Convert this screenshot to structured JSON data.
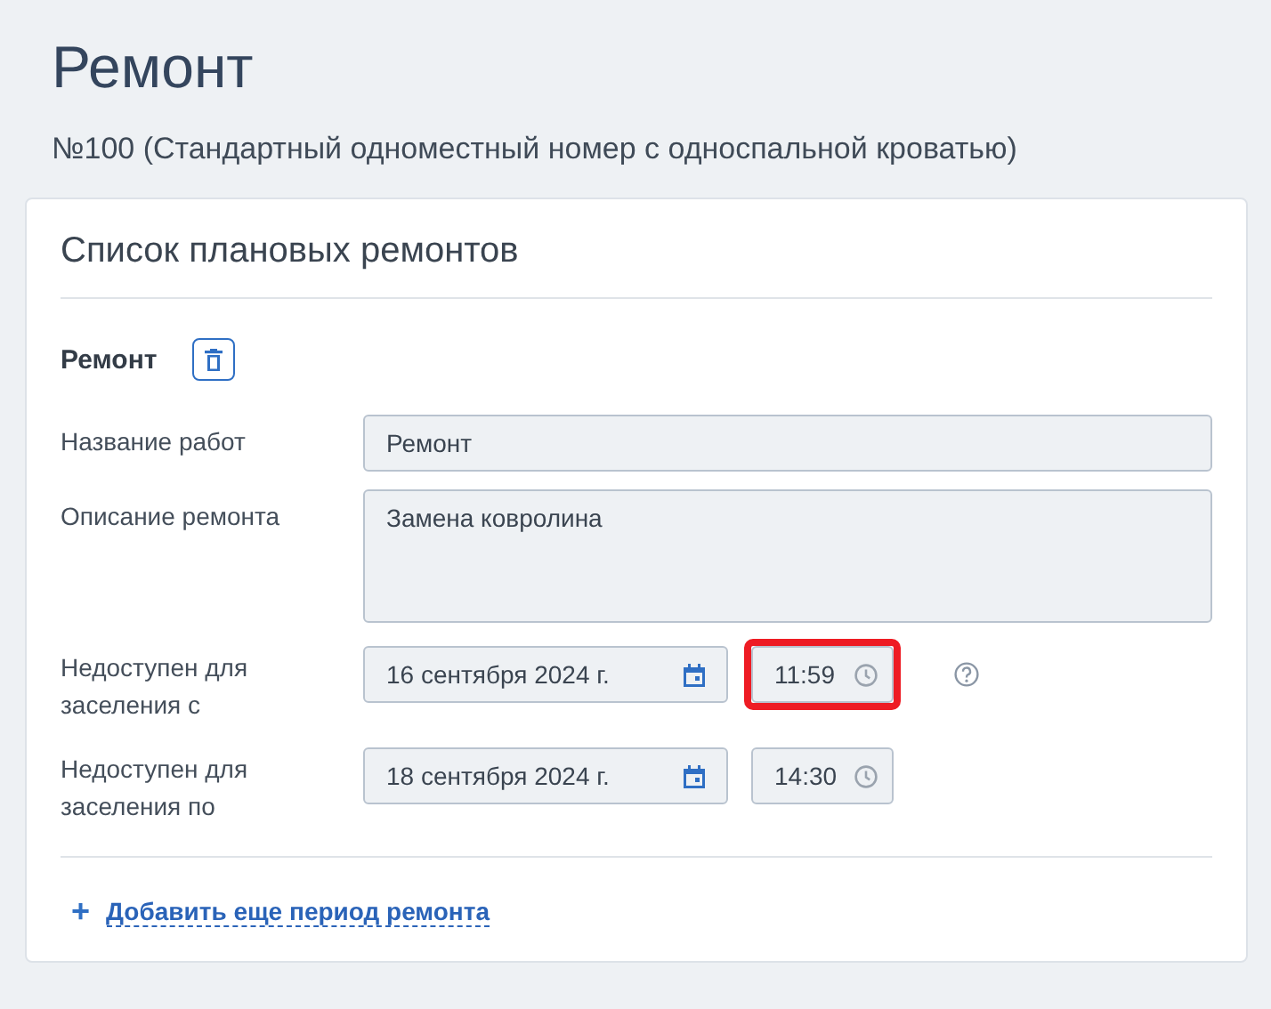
{
  "page": {
    "title": "Ремонт",
    "subtitle": "№100 (Стандартный одноместный номер с односпальной кроватью)"
  },
  "card": {
    "title": "Список плановых ремонтов",
    "section_title": "Ремонт",
    "fields": [
      {
        "kind": "text",
        "label": "Название работ",
        "value": "Ремонт"
      },
      {
        "kind": "textarea",
        "label": "Описание ремонта",
        "value": "Замена ковролина"
      },
      {
        "kind": "datetime",
        "label": "Недоступен для заселения с",
        "date": "16 сентября 2024 г.",
        "time": "11:59",
        "time_highlighted": true,
        "help": true
      },
      {
        "kind": "datetime",
        "label": "Недоступен для заселения по",
        "date": "18 сентября 2024 г.",
        "time": "14:30",
        "time_highlighted": false,
        "help": false
      }
    ],
    "add_link": {
      "icon": "+",
      "label": "Добавить еще период ремонта"
    }
  }
}
